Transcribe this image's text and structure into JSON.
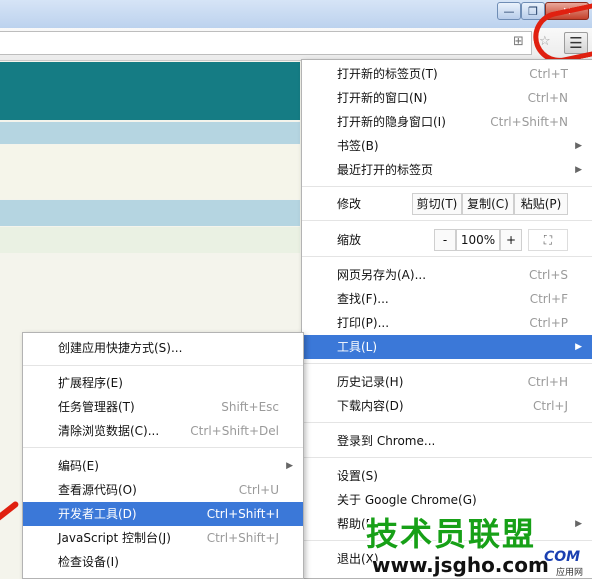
{
  "titlebar": {
    "min": "—",
    "max": "❐",
    "close": "✕"
  },
  "toolbar": {
    "translate_icon": "⊞",
    "star_icon": "☆",
    "menu_icon": "☰"
  },
  "main_menu": {
    "new_tab": {
      "label": "打开新的标签页(T)",
      "shortcut": "Ctrl+T"
    },
    "new_window": {
      "label": "打开新的窗口(N)",
      "shortcut": "Ctrl+N"
    },
    "incognito": {
      "label": "打开新的隐身窗口(I)",
      "shortcut": "Ctrl+Shift+N"
    },
    "bookmarks": {
      "label": "书签(B)"
    },
    "recent_tabs": {
      "label": "最近打开的标签页"
    },
    "edit": {
      "label": "修改",
      "cut": "剪切(T)",
      "copy": "复制(C)",
      "paste": "粘贴(P)"
    },
    "zoom": {
      "label": "缩放",
      "minus": "-",
      "value": "100%",
      "plus": "+",
      "fullscreen": "⛶"
    },
    "save_as": {
      "label": "网页另存为(A)...",
      "shortcut": "Ctrl+S"
    },
    "find": {
      "label": "查找(F)...",
      "shortcut": "Ctrl+F"
    },
    "print": {
      "label": "打印(P)...",
      "shortcut": "Ctrl+P"
    },
    "tools": {
      "label": "工具(L)"
    },
    "history": {
      "label": "历史记录(H)",
      "shortcut": "Ctrl+H"
    },
    "downloads": {
      "label": "下载内容(D)",
      "shortcut": "Ctrl+J"
    },
    "signin": {
      "label": "登录到 Chrome..."
    },
    "settings": {
      "label": "设置(S)"
    },
    "about": {
      "label": "关于 Google Chrome(G)"
    },
    "help": {
      "label": "帮助(E)"
    },
    "exit": {
      "label": "退出(X)"
    }
  },
  "tools_menu": {
    "create_shortcut": {
      "label": "创建应用快捷方式(S)..."
    },
    "extensions": {
      "label": "扩展程序(E)"
    },
    "task_manager": {
      "label": "任务管理器(T)",
      "shortcut": "Shift+Esc"
    },
    "clear_data": {
      "label": "清除浏览数据(C)...",
      "shortcut": "Ctrl+Shift+Del"
    },
    "encoding": {
      "label": "编码(E)"
    },
    "view_source": {
      "label": "查看源代码(O)",
      "shortcut": "Ctrl+U"
    },
    "dev_tools": {
      "label": "开发者工具(D)",
      "shortcut": "Ctrl+Shift+I"
    },
    "js_console": {
      "label": "JavaScript 控制台(J)",
      "shortcut": "Ctrl+Shift+J"
    },
    "inspect_devices": {
      "label": "检查设备(I)"
    }
  },
  "watermark": {
    "title": "技术员联盟",
    "url": "www.jsgho.com",
    "com": "COM",
    "tag": "应用网"
  },
  "colors": {
    "highlight": "#3b78d8",
    "annotation_red": "#e02010",
    "watermark_green": "#17a017"
  }
}
